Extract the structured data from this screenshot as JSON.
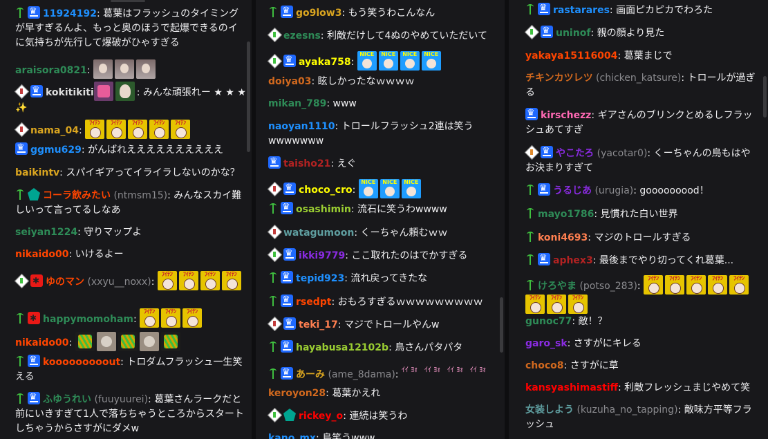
{
  "colors": {
    "background": "#18181b",
    "text": "#efeff1",
    "secondary": "#8a8a8e"
  },
  "chats": [
    {
      "messages": [
        {
          "user": "11924192",
          "color": "#1e90ff",
          "text": ": 葛葉はフラッシュのタイミングが早すぎるんよ、もっと奥のほうで起爆できるのイに気持ちが先行して爆破がひゃすぎる"
        },
        {
          "user": "araisora0821",
          "color": "#2e8b57",
          "text": ": "
        },
        {
          "user": "kokitikiti",
          "color": "#dedede",
          "text": ": みんな頑張れー ★ ★ ★ ✨"
        },
        {
          "user": "nama_04",
          "color": "#daa520",
          "text": ": "
        },
        {
          "user": "ggmu629",
          "color": "#1e90ff",
          "text": ": がんばれええええええええええ"
        },
        {
          "user": "baikintv",
          "color": "#daa520",
          "text": ": スパイギアってイライラしないのかな？"
        },
        {
          "user": "コーラ飲みたい",
          "sub": "(ntmsm15)",
          "color": "#ff4500",
          "text": ": みんなスカイ難しいって言ってるしなあ"
        },
        {
          "user": "seiyan1224",
          "color": "#2e8b57",
          "text": ": 守りマップよ"
        },
        {
          "user": "nikaido00",
          "color": "#ff4500",
          "text": ": いけるよー"
        },
        {
          "user": "ゆのマン",
          "sub": "(xxyu__noxx)",
          "color": "#ff4500",
          "text": ": "
        },
        {
          "user": "happymomoham",
          "color": "#2e8b57",
          "text": ": "
        },
        {
          "user": "nikaido00",
          "color": "#ff4500",
          "text": ": "
        },
        {
          "user": "kooooooooout",
          "color": "#ff4500",
          "text": ": トロダムフラッシュ一生笑える"
        },
        {
          "user": "ふゆうれい",
          "sub": "(fuuyuurei)",
          "color": "#2e8b57",
          "text": ": 葛葉さんラークだと前にいきすぎて1人で落ちちゃうところからスタートしちゃうからさすがにダメw"
        }
      ]
    },
    {
      "messages": [
        {
          "user": "go9low3",
          "color": "#daa520",
          "text": ": もう笑うわこんなん"
        },
        {
          "user": "ezesns",
          "color": "#2e8b57",
          "text": ": 利敵だけして4ぬのやめていただいて"
        },
        {
          "user": "ayaka758",
          "color": "#ffff00",
          "text": ": "
        },
        {
          "user": "doiya03",
          "color": "#d2691e",
          "text": ": 眩しかったなｗｗｗｗ"
        },
        {
          "user": "mikan_789",
          "color": "#2e8b57",
          "text": ": www"
        },
        {
          "user": "naoyan1110",
          "color": "#1e90ff",
          "text": ": トロールフラッシュ2連は笑うwwwwwww"
        },
        {
          "user": "taisho21",
          "color": "#b22222",
          "text": ": えぐ"
        },
        {
          "user": "choco_cro",
          "color": "#ffff00",
          "text": ": "
        },
        {
          "user": "osashimin",
          "color": "#9acd32",
          "text": ": 流石に笑うわwwww"
        },
        {
          "user": "watagumoon",
          "color": "#5f9ea0",
          "text": ": くーちゃん頼むｗｗ"
        },
        {
          "user": "ikki9779",
          "color": "#8a2be2",
          "text": ": ここ取れたのはでかすぎる"
        },
        {
          "user": "tepid923",
          "color": "#1e90ff",
          "text": ": 流れ戻ってきたな"
        },
        {
          "user": "rsedpt",
          "color": "#ff4500",
          "text": ": おもろすぎるｗｗｗｗｗｗｗｗｗ"
        },
        {
          "user": "teki_17",
          "color": "#ff7f50",
          "text": ": マジでトロールやんw"
        },
        {
          "user": "hayabusa12102b",
          "color": "#9acd32",
          "text": ": 鳥さんパタパタ"
        },
        {
          "user": "あーみ",
          "sub": "(ame_8dama)",
          "color": "#daa520",
          "text": ": "
        },
        {
          "user": "keroyon28",
          "color": "#d2691e",
          "text": ": 葛葉かえれ"
        },
        {
          "user": "rickey_o",
          "color": "#ff0000",
          "text": ": 連続は笑うわ"
        },
        {
          "user": "kano_mx",
          "color": "#1e90ff",
          "text": ": 鳥笑うwww"
        }
      ]
    },
    {
      "messages": [
        {
          "user": "rastarares",
          "color": "#1e90ff",
          "text": ": 画面ピカピカでわろた"
        },
        {
          "user": "uninof",
          "color": "#2e8b57",
          "text": ": 親の顔より見た"
        },
        {
          "user": "yakaya15116004",
          "color": "#ff4500",
          "text": ": 葛葉まじで"
        },
        {
          "user": "チキンカツレツ",
          "sub": "(chicken_katsure)",
          "color": "#d2691e",
          "text": ": トロールが過ぎる"
        },
        {
          "user": "kirschezz",
          "color": "#ff69b4",
          "text": ": ギアさんのブリンクとめるしフラッシュあてすぎ"
        },
        {
          "user": "やこたろ",
          "sub": "(yacotar0)",
          "color": "#8a2be2",
          "text": ": くーちゃんの鳥もはやお決まりすぎて"
        },
        {
          "user": "うるじあ",
          "sub": "(urugia)",
          "color": "#8a2be2",
          "text": ": gooooooood！"
        },
        {
          "user": "mayo1786",
          "color": "#2e8b57",
          "text": ": 見慣れた白い世界"
        },
        {
          "user": "koni4693",
          "color": "#ff7f50",
          "text": ": マジのトロールすぎる"
        },
        {
          "user": "aphex3",
          "color": "#b22222",
          "text": ": 最後までやり切ってくれ葛葉..."
        },
        {
          "user": "けろやま",
          "sub": "(potso_283)",
          "color": "#2e8b57",
          "text": ": "
        },
        {
          "user": "gunoc77",
          "color": "#2e8b57",
          "text": ": 敵！？"
        },
        {
          "user": "garo_sk",
          "color": "#8a2be2",
          "text": ": さすがにキレる"
        },
        {
          "user": "choco8",
          "color": "#d2691e",
          "text": ": さすがに草"
        },
        {
          "user": "kansyashimastiff",
          "color": "#ff0000",
          "text": ": 利敵フレッシュまじやめて笑"
        },
        {
          "user": "女装しよう",
          "sub": "(kuzuha_no_tapping)",
          "color": "#5f9ea0",
          "text": ": 敵味方平等フラッシュ"
        }
      ]
    }
  ]
}
